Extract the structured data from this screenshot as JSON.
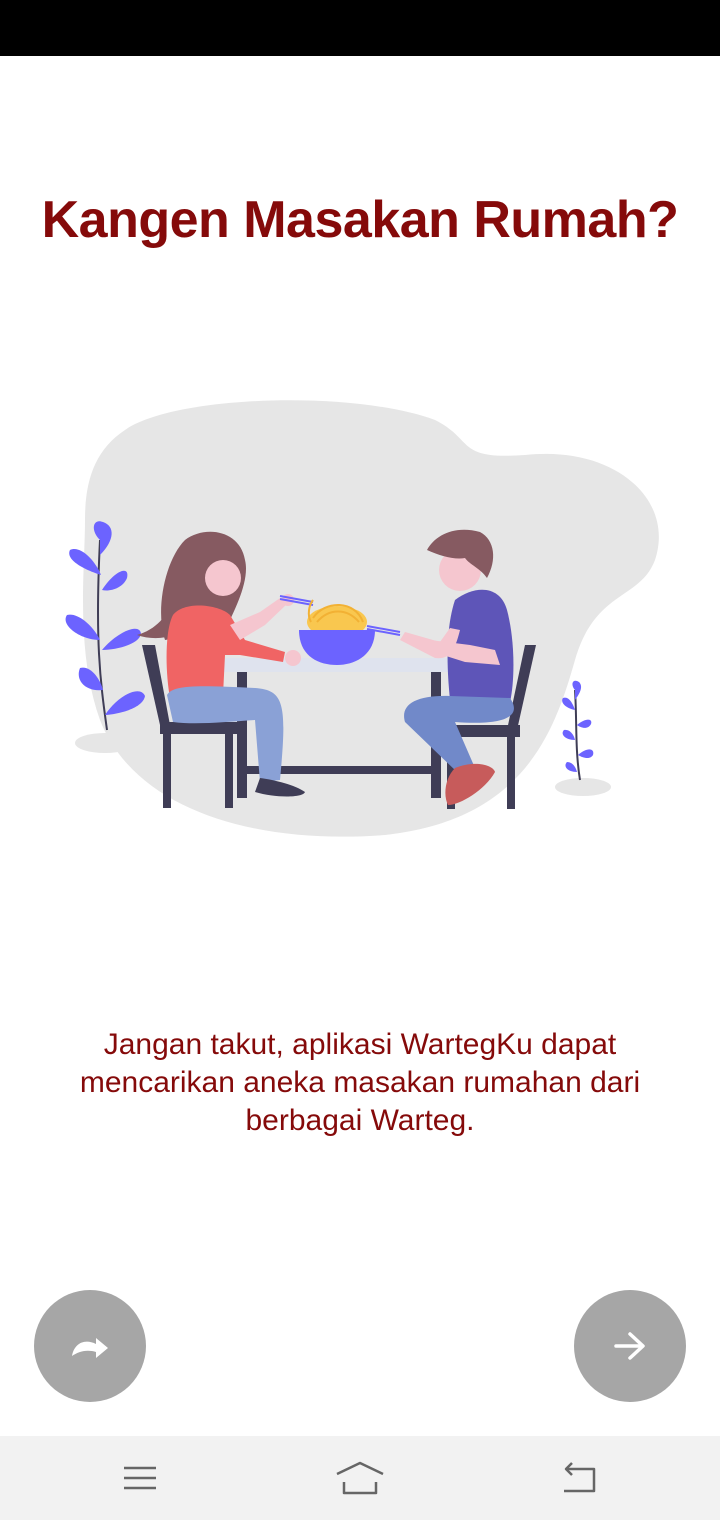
{
  "onboarding": {
    "title": "Kangen Masakan Rumah?",
    "description": "Jangan takut, aplikasi WartegKu dapat mencarikan aneka masakan rumahan dari berbagai Warteg."
  },
  "buttons": {
    "skip_icon": "redo-arrow-icon",
    "next_icon": "arrow-right-icon"
  },
  "nav_bar": {
    "icons": [
      "menu-icon",
      "home-icon",
      "back-icon"
    ]
  },
  "colors": {
    "primary_text": "#850a0a",
    "fab_background": "#a6a6a6",
    "accent_purple": "#6c63ff",
    "nav_bar": "#f2f2f2",
    "status_bar": "#000000"
  }
}
